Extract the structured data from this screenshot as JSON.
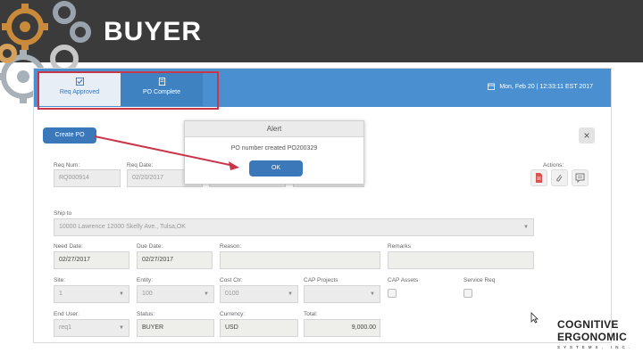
{
  "slide": {
    "title": "BUYER"
  },
  "topbar": {
    "tabs": [
      {
        "label": "Req Approved",
        "icon": "check-square-icon",
        "active": true
      },
      {
        "label": "PO Complete",
        "icon": "document-icon",
        "active": false
      }
    ],
    "datetime": "Mon, Feb 20 | 12:33:11 EST 2017"
  },
  "toolbar": {
    "create_po_label": "Create PO",
    "close_label": "×"
  },
  "alert": {
    "title": "Alert",
    "message": "PO number created PO200329",
    "ok_label": "OK"
  },
  "form": {
    "req_num": {
      "label": "Req Num:",
      "value": "RQ000914"
    },
    "req_date": {
      "label": "Req Date:",
      "value": "02/20/2017"
    },
    "actions_label": "Actions:",
    "ship_to": {
      "label": "Ship to",
      "value": "10000 Lawrence 12000 Skelly Ave., Tulsa,OK"
    },
    "need_date": {
      "label": "Need Date:",
      "value": "02/27/2017"
    },
    "due_date": {
      "label": "Due Date:",
      "value": "02/27/2017"
    },
    "reason": {
      "label": "Reason:",
      "value": ""
    },
    "remarks": {
      "label": "Remarks",
      "value": ""
    },
    "site": {
      "label": "Site:",
      "value": "1"
    },
    "entity": {
      "label": "Entity:",
      "value": "100"
    },
    "cost_ctr": {
      "label": "Cost Ctr:",
      "value": "0100"
    },
    "cap_projects": {
      "label": "CAP Projects",
      "value": ""
    },
    "cap_assets": {
      "label": "CAP Assets"
    },
    "service_req": {
      "label": "Service Req"
    },
    "end_user": {
      "label": "End User:",
      "value": "req1"
    },
    "status": {
      "label": "Status:",
      "value": "BUYER"
    },
    "currency": {
      "label": "Currency:",
      "value": "USD"
    },
    "total": {
      "label": "Total:",
      "value": "9,000.00"
    }
  },
  "logo": {
    "line1": "COGNITIVE",
    "line2": "ERGONOMIC",
    "line3": "SYSTEMS, INC."
  },
  "colors": {
    "topbar": "#4a90d0",
    "button": "#3a78b9",
    "highlight": "#c8364a",
    "title_bar": "#3b3b3b"
  }
}
